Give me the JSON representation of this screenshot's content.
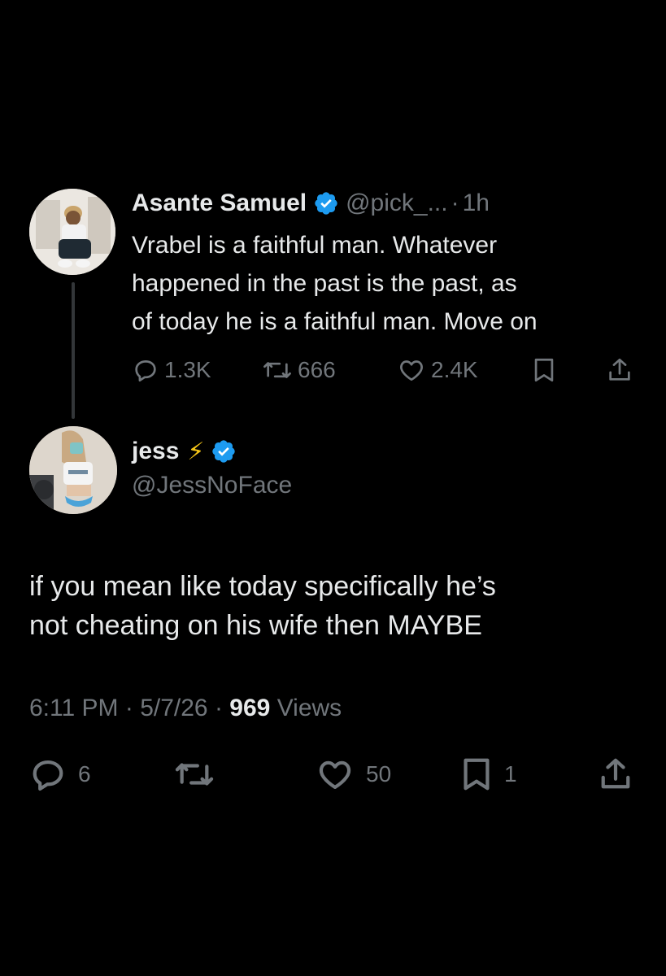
{
  "parent_tweet": {
    "author_name": "Asante Samuel",
    "handle": "@pick_...",
    "separator": "·",
    "time_ago": "1h",
    "text": "Vrabel is a faithful man. Whatever\nhappened in the past is the past, as\nof today he is a faithful man. Move on",
    "replies": "1.3K",
    "retweets": "666",
    "likes": "2.4K",
    "verified": true
  },
  "main_tweet": {
    "author_name": "jess",
    "emoji": "⚡",
    "handle": "@JessNoFace",
    "text": "if you mean like today specifically he’s\nnot cheating on his wife then MAYBE",
    "time": "6:11 PM",
    "date": "5/7/26",
    "separator": "·",
    "views_count": "969",
    "views_label": "Views",
    "replies": "6",
    "likes": "50",
    "bookmarks": "1",
    "verified": true
  },
  "colors": {
    "background": "#000000",
    "primary_text": "#e7e9ea",
    "secondary_text": "#71767b",
    "verified_blue": "#1d9bf0",
    "thread_line": "#333639"
  },
  "icons": {
    "reply": "reply-icon",
    "retweet": "retweet-icon",
    "like": "heart-icon",
    "bookmark": "bookmark-icon",
    "share": "share-icon",
    "verified": "verified-badge-icon"
  }
}
